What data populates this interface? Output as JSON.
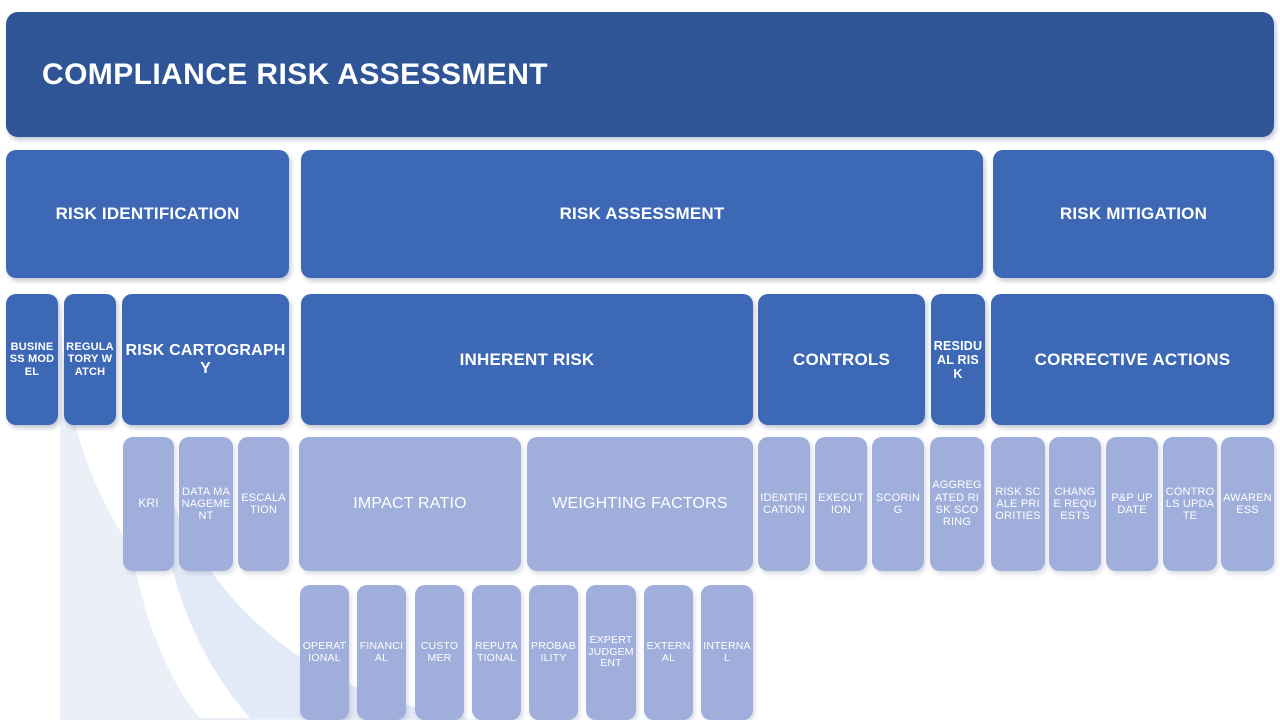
{
  "slide": {
    "title": "COMPLIANCE RISK ASSESSMENT",
    "colors": {
      "title_banner": "#2F5597",
      "process_box": "#3C68B5",
      "leaf_box": "#9FAEDA",
      "text": "#FFFFFF",
      "background": "#FFFFFF",
      "decor_arc": "#E7ECF7"
    }
  },
  "level1": [
    {
      "label": "RISK IDENTIFICATION"
    },
    {
      "label": "RISK ASSESSMENT"
    },
    {
      "label": "RISK MITIGATION"
    }
  ],
  "level2": [
    {
      "label": "BUSINESS MODEL"
    },
    {
      "label": "REGULATORY WATCH"
    },
    {
      "label": "RISK CARTOGRAPHY"
    },
    {
      "label": "INHERENT RISK"
    },
    {
      "label": "CONTROLS"
    },
    {
      "label": "RESIDUAL RISK"
    },
    {
      "label": "CORRECTIVE ACTIONS"
    }
  ],
  "level3": [
    {
      "label": "KRI"
    },
    {
      "label": "DATA MANAGEMENT"
    },
    {
      "label": "ESCALATION"
    },
    {
      "label": "IMPACT RATIO"
    },
    {
      "label": "WEIGHTING FACTORS"
    },
    {
      "label": "IDENTIFICATION"
    },
    {
      "label": "EXECUTION"
    },
    {
      "label": "SCORING"
    },
    {
      "label": "AGGREGATED RISK SCORING"
    },
    {
      "label": "RISK SCALE PRIORITIES"
    },
    {
      "label": "CHANGE REQUESTS"
    },
    {
      "label": "P&P UPDATE"
    },
    {
      "label": "CONTROLS UPDATE"
    },
    {
      "label": "AWARENESS"
    }
  ],
  "level4": [
    {
      "label": "OPERATIONAL"
    },
    {
      "label": "FINANCIAL"
    },
    {
      "label": "CUSTOMER"
    },
    {
      "label": "REPUTATIONAL"
    },
    {
      "label": "PROBABILITY"
    },
    {
      "label": "EXPERT JUDGEMENT"
    },
    {
      "label": "EXTERNAL"
    },
    {
      "label": "INTERNAL"
    }
  ]
}
